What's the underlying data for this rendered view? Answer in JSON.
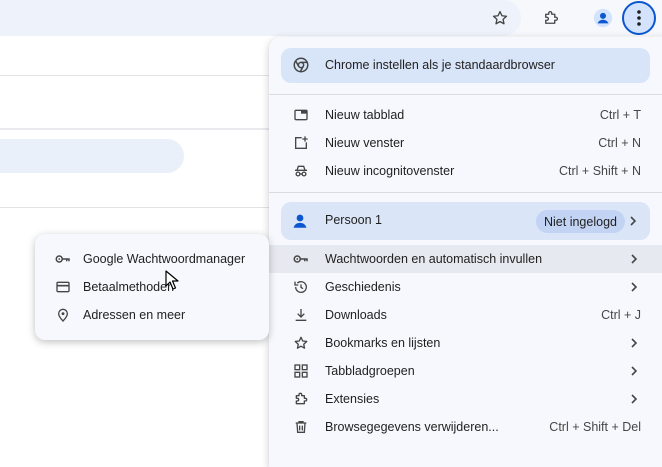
{
  "toolbar": {
    "icons": [
      "star-icon",
      "extensions-icon",
      "profile-avatar-icon",
      "more-vert-icon"
    ],
    "accent_color": "#0b57d0"
  },
  "menu": {
    "default_browser_label": "Chrome instellen als je standaardbrowser",
    "new_tab": {
      "label": "Nieuw tabblad",
      "shortcut": "Ctrl + T"
    },
    "new_window": {
      "label": "Nieuw venster",
      "shortcut": "Ctrl + N"
    },
    "new_incognito": {
      "label": "Nieuw incognitovenster",
      "shortcut": "Ctrl + Shift + N"
    },
    "profile": {
      "name": "Persoon 1",
      "status": "Niet ingelogd"
    },
    "passwords_autofill": {
      "label": "Wachtwoorden en automatisch invullen"
    },
    "history": {
      "label": "Geschiedenis"
    },
    "downloads": {
      "label": "Downloads",
      "shortcut": "Ctrl + J"
    },
    "bookmarks": {
      "label": "Bookmarks en lijsten"
    },
    "tab_groups": {
      "label": "Tabbladgroepen"
    },
    "extensions": {
      "label": "Extensies"
    },
    "clear_data": {
      "label": "Browsegegevens verwijderen...",
      "shortcut": "Ctrl + Shift + Del"
    }
  },
  "submenu": {
    "password_manager": "Google Wachtwoordmanager",
    "payment_methods": "Betaalmethoden",
    "addresses": "Adressen en meer"
  }
}
